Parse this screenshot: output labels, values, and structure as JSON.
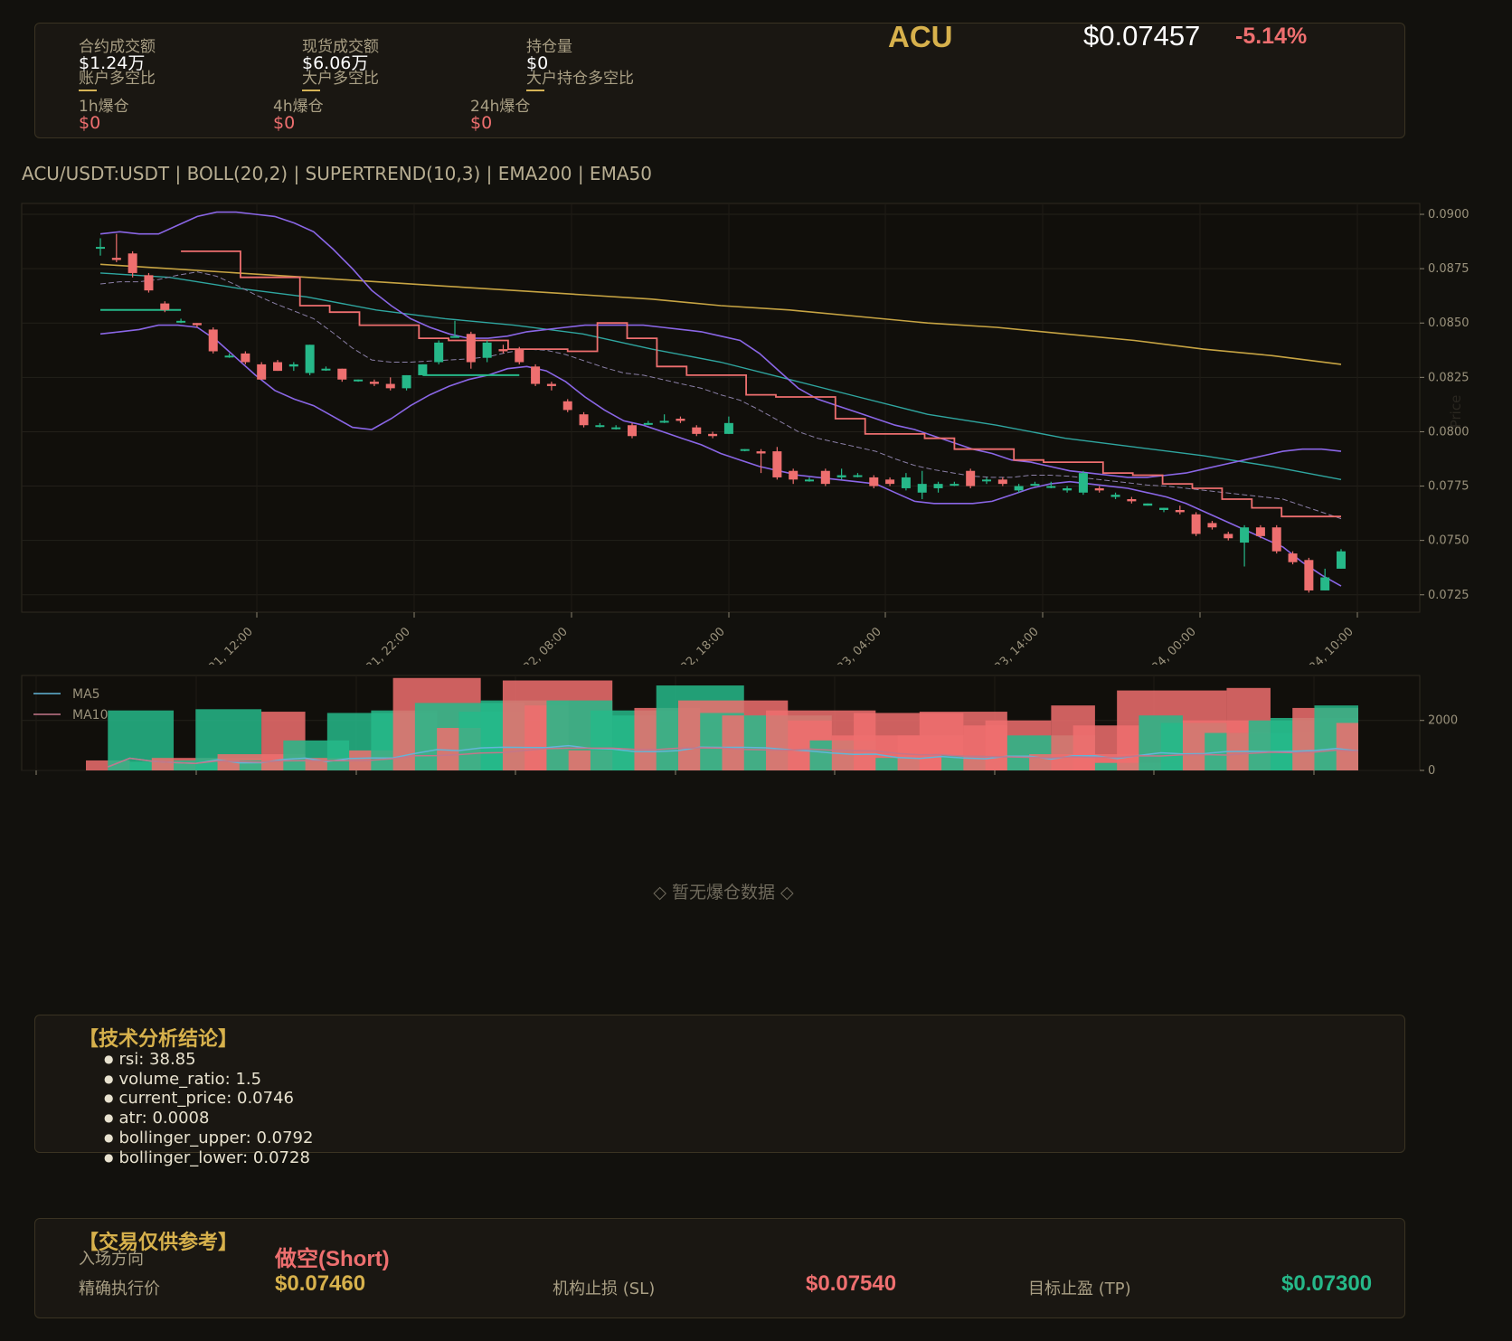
{
  "header": {
    "symbol": "ACU",
    "price": "$0.07457",
    "change": "-5.14%",
    "stats": [
      {
        "label": "合约成交额",
        "value": "$1.24万",
        "sub": "账户多空比"
      },
      {
        "label": "现货成交额",
        "value": "$6.06万",
        "sub": "大户多空比"
      },
      {
        "label": "持仓量",
        "value": "$0",
        "sub": "大户持仓多空比"
      }
    ],
    "liquidations": [
      {
        "label": "1h爆仓",
        "value": "$0"
      },
      {
        "label": "4h爆仓",
        "value": "$0"
      },
      {
        "label": "24h爆仓",
        "value": "$0"
      }
    ]
  },
  "chart_title": "ACU/USDT:USDT | BOLL(20,2) | SUPERTREND(10,3) | EMA200 | EMA50",
  "liquidation_empty": "◇ 暂无爆仓数据 ◇",
  "analysis": {
    "title": "【技术分析结论】",
    "items": [
      "rsi: 38.85",
      "volume_ratio: 1.5",
      "current_price: 0.0746",
      "atr: 0.0008",
      "bollinger_upper: 0.0792",
      "bollinger_lower: 0.0728"
    ]
  },
  "trade": {
    "title": "【交易仅供参考】",
    "direction_label": "入场方向",
    "direction_value": "做空(Short)",
    "entry_label": "精确执行价",
    "entry_value": "$0.07460",
    "sl_label": "机构止损 (SL)",
    "sl_value": "$0.07540",
    "tp_label": "目标止盈 (TP)",
    "tp_value": "$0.07300"
  },
  "colors": {
    "up": "#26b889",
    "down": "#ee6f6f",
    "ema200": "#c7a443",
    "ema50": "#2fa6a0",
    "boll": "#8a66e6",
    "supertrend": "#ee6f6f",
    "accent": "#d7b14c"
  },
  "chart_data": [
    {
      "type": "candlestick",
      "y_label": "Price",
      "ylim": [
        0.0717,
        0.0905
      ],
      "yticks": [
        "0.0725",
        "0.0750",
        "0.0775",
        "0.0800",
        "0.0825",
        "0.0850",
        "0.0875",
        "0.0900"
      ],
      "xticks": [
        "Jun 21, 12:00",
        "Jun 21, 22:00",
        "Jun 22, 08:00",
        "Jun 22, 18:00",
        "Jun 23, 04:00",
        "Jun 23, 14:00",
        "Jun 24, 00:00",
        "Jun 24, 10:00"
      ],
      "candles": [
        [
          0.0885,
          0.0889,
          0.0881,
          0.0885
        ],
        [
          0.088,
          0.0891,
          0.0878,
          0.0879
        ],
        [
          0.0882,
          0.0883,
          0.0871,
          0.0873
        ],
        [
          0.0872,
          0.0873,
          0.0864,
          0.0865
        ],
        [
          0.0859,
          0.086,
          0.0855,
          0.0856
        ],
        [
          0.0851,
          0.0852,
          0.085,
          0.0851
        ],
        [
          0.085,
          0.085,
          0.0848,
          0.0849
        ],
        [
          0.0847,
          0.0848,
          0.0836,
          0.0837
        ],
        [
          0.0835,
          0.0836,
          0.0834,
          0.0835
        ],
        [
          0.0836,
          0.0837,
          0.0831,
          0.0832
        ],
        [
          0.0831,
          0.0832,
          0.0824,
          0.0824
        ],
        [
          0.0832,
          0.0833,
          0.0828,
          0.0828
        ],
        [
          0.083,
          0.0832,
          0.0828,
          0.0831
        ],
        [
          0.0827,
          0.084,
          0.0826,
          0.084
        ],
        [
          0.0829,
          0.083,
          0.0828,
          0.0829
        ],
        [
          0.0829,
          0.0829,
          0.0823,
          0.0824
        ],
        [
          0.0824,
          0.0824,
          0.0823,
          0.0824
        ],
        [
          0.0823,
          0.0824,
          0.0821,
          0.0822
        ],
        [
          0.0822,
          0.0825,
          0.0819,
          0.082
        ],
        [
          0.082,
          0.0826,
          0.0819,
          0.0826
        ],
        [
          0.0826,
          0.0831,
          0.0826,
          0.0831
        ],
        [
          0.0832,
          0.0842,
          0.0831,
          0.0841
        ],
        [
          0.0844,
          0.0851,
          0.0844,
          0.0844
        ],
        [
          0.0845,
          0.0846,
          0.0829,
          0.0832
        ],
        [
          0.0834,
          0.0842,
          0.0832,
          0.0841
        ],
        [
          0.0838,
          0.084,
          0.0836,
          0.0837
        ],
        [
          0.0838,
          0.0839,
          0.0831,
          0.0832
        ],
        [
          0.083,
          0.0831,
          0.0821,
          0.0822
        ],
        [
          0.0822,
          0.0823,
          0.0819,
          0.0821
        ],
        [
          0.0814,
          0.0815,
          0.0809,
          0.081
        ],
        [
          0.0808,
          0.0809,
          0.0802,
          0.0803
        ],
        [
          0.0803,
          0.0804,
          0.0802,
          0.0803
        ],
        [
          0.0802,
          0.0803,
          0.0801,
          0.0802
        ],
        [
          0.0803,
          0.0804,
          0.0797,
          0.0798
        ],
        [
          0.0804,
          0.0805,
          0.0803,
          0.0804
        ],
        [
          0.0805,
          0.0808,
          0.0804,
          0.0805
        ],
        [
          0.0806,
          0.0807,
          0.0804,
          0.0805
        ],
        [
          0.0802,
          0.0803,
          0.0798,
          0.0799
        ],
        [
          0.0799,
          0.08,
          0.0797,
          0.0798
        ],
        [
          0.0799,
          0.0807,
          0.0799,
          0.0804
        ],
        [
          0.0792,
          0.0792,
          0.0791,
          0.0792
        ],
        [
          0.0791,
          0.0792,
          0.0781,
          0.079
        ],
        [
          0.0791,
          0.0793,
          0.0778,
          0.0779
        ],
        [
          0.0782,
          0.0783,
          0.0776,
          0.0778
        ],
        [
          0.0778,
          0.0779,
          0.0777,
          0.0778
        ],
        [
          0.0782,
          0.0783,
          0.0775,
          0.0776
        ],
        [
          0.0779,
          0.0783,
          0.0778,
          0.078
        ],
        [
          0.078,
          0.0781,
          0.0779,
          0.078
        ],
        [
          0.0779,
          0.078,
          0.0774,
          0.0775
        ],
        [
          0.0778,
          0.0779,
          0.0775,
          0.0776
        ],
        [
          0.0774,
          0.0781,
          0.0773,
          0.0779
        ],
        [
          0.0772,
          0.0782,
          0.0769,
          0.0776
        ],
        [
          0.0774,
          0.0777,
          0.0772,
          0.0776
        ],
        [
          0.0776,
          0.0777,
          0.0775,
          0.0776
        ],
        [
          0.0782,
          0.0783,
          0.0774,
          0.0775
        ],
        [
          0.0778,
          0.0779,
          0.0776,
          0.0778
        ],
        [
          0.0778,
          0.0779,
          0.0775,
          0.0776
        ],
        [
          0.0773,
          0.0776,
          0.0772,
          0.0775
        ],
        [
          0.0776,
          0.0777,
          0.0775,
          0.0776
        ],
        [
          0.0775,
          0.0777,
          0.0774,
          0.0775
        ],
        [
          0.0773,
          0.0775,
          0.0772,
          0.0774
        ],
        [
          0.0772,
          0.0782,
          0.0771,
          0.0781
        ],
        [
          0.0774,
          0.0775,
          0.0772,
          0.0773
        ],
        [
          0.077,
          0.0772,
          0.0769,
          0.0771
        ],
        [
          0.0769,
          0.077,
          0.0767,
          0.0768
        ],
        [
          0.0766,
          0.0767,
          0.0766,
          0.0767
        ],
        [
          0.0764,
          0.0765,
          0.0763,
          0.0765
        ],
        [
          0.0764,
          0.0766,
          0.0762,
          0.0763
        ],
        [
          0.0762,
          0.0763,
          0.0752,
          0.0753
        ],
        [
          0.0758,
          0.0759,
          0.0755,
          0.0756
        ],
        [
          0.0753,
          0.0754,
          0.075,
          0.0751
        ],
        [
          0.0749,
          0.0757,
          0.0738,
          0.0756
        ],
        [
          0.0756,
          0.0757,
          0.0751,
          0.0752
        ],
        [
          0.0756,
          0.0757,
          0.0744,
          0.0745
        ],
        [
          0.0744,
          0.0745,
          0.0739,
          0.074
        ],
        [
          0.0741,
          0.0742,
          0.0726,
          0.0727
        ],
        [
          0.0727,
          0.0737,
          0.0727,
          0.0733
        ],
        [
          0.0737,
          0.0746,
          0.0737,
          0.0745
        ]
      ],
      "boll_upper": [
        0.0891,
        0.0892,
        0.0891,
        0.0891,
        0.0895,
        0.0899,
        0.0901,
        0.0901,
        0.09,
        0.0899,
        0.0896,
        0.0892,
        0.0884,
        0.0875,
        0.0865,
        0.0858,
        0.0852,
        0.0848,
        0.0845,
        0.0843,
        0.0843,
        0.0844,
        0.0846,
        0.0847,
        0.0848,
        0.0849,
        0.0849,
        0.0849,
        0.0849,
        0.0848,
        0.0847,
        0.0846,
        0.0844,
        0.0842,
        0.0836,
        0.0828,
        0.082,
        0.0815,
        0.0812,
        0.0809,
        0.0806,
        0.0803,
        0.0801,
        0.0798,
        0.0795,
        0.0792,
        0.079,
        0.0787,
        0.0786,
        0.0784,
        0.0782,
        0.0781,
        0.078,
        0.0779,
        0.0779,
        0.078,
        0.0781,
        0.0783,
        0.0785,
        0.0787,
        0.0789,
        0.0791,
        0.0792,
        0.0792,
        0.0791
      ],
      "boll_lower": [
        0.0845,
        0.0846,
        0.0847,
        0.0849,
        0.0849,
        0.0848,
        0.0842,
        0.0834,
        0.0826,
        0.0819,
        0.0815,
        0.0812,
        0.0807,
        0.0802,
        0.0801,
        0.0806,
        0.0812,
        0.0817,
        0.0821,
        0.0824,
        0.0826,
        0.0829,
        0.083,
        0.0828,
        0.0823,
        0.0816,
        0.081,
        0.0805,
        0.0803,
        0.08,
        0.0797,
        0.0794,
        0.079,
        0.0787,
        0.0784,
        0.0782,
        0.078,
        0.0779,
        0.0778,
        0.0777,
        0.0776,
        0.0772,
        0.0768,
        0.0767,
        0.0767,
        0.0767,
        0.0768,
        0.0771,
        0.0774,
        0.0776,
        0.0777,
        0.0776,
        0.0775,
        0.0774,
        0.0772,
        0.077,
        0.0767,
        0.0763,
        0.0759,
        0.0755,
        0.0751,
        0.0747,
        0.074,
        0.0734,
        0.0729
      ],
      "ema200": [
        0.0877,
        0.0875,
        0.0873,
        0.0871,
        0.0869,
        0.0867,
        0.0865,
        0.0863,
        0.0861,
        0.0858,
        0.0856,
        0.0853,
        0.085,
        0.0848,
        0.0845,
        0.0842,
        0.0838,
        0.0835,
        0.0831
      ],
      "ema50": [
        0.0873,
        0.0871,
        0.0866,
        0.0862,
        0.0856,
        0.0852,
        0.0849,
        0.0845,
        0.0838,
        0.0832,
        0.0824,
        0.0816,
        0.0808,
        0.0803,
        0.0797,
        0.0793,
        0.0789,
        0.0784,
        0.0778
      ],
      "supertrend_down": [
        0.0883,
        0.0883,
        0.0871,
        0.0871,
        0.0858,
        0.0855,
        0.0849,
        0.0849,
        0.0843,
        0.0842,
        0.0842,
        0.0838,
        0.0838,
        0.0837,
        0.085,
        0.0843,
        0.083,
        0.0826,
        0.0826,
        0.0817,
        0.0816,
        0.0816,
        0.0806,
        0.0799,
        0.0799,
        0.0797,
        0.0792,
        0.0792,
        0.0787,
        0.0786,
        0.0786,
        0.0781,
        0.078,
        0.0776,
        0.0774,
        0.0769,
        0.0765,
        0.0761,
        0.0761
      ],
      "supertrend_up": [
        0.0856,
        0.0856,
        0.0856,
        0.0826,
        0.0826,
        0.0826
      ]
    },
    {
      "type": "bar",
      "series": [
        {
          "name": "MA5"
        },
        {
          "name": "MA10"
        }
      ],
      "yticks": [
        "0",
        "2000"
      ],
      "ylim": [
        0,
        3800
      ],
      "volumes": [
        [
          0,
          400
        ],
        [
          1,
          2400
        ],
        [
          1,
          350
        ],
        [
          0,
          500
        ],
        [
          1,
          400
        ],
        [
          1,
          2450
        ],
        [
          0,
          650
        ],
        [
          1,
          400
        ],
        [
          0,
          2350
        ],
        [
          1,
          1200
        ],
        [
          0,
          500
        ],
        [
          1,
          2300
        ],
        [
          0,
          800
        ],
        [
          1,
          2400
        ],
        [
          0,
          3700
        ],
        [
          1,
          2700
        ],
        [
          0,
          1700
        ],
        [
          1,
          2350
        ],
        [
          1,
          2800
        ],
        [
          0,
          3600
        ],
        [
          0,
          2600
        ],
        [
          1,
          2800
        ],
        [
          0,
          800
        ],
        [
          1,
          2400
        ],
        [
          1,
          2200
        ],
        [
          0,
          2500
        ],
        [
          1,
          3400
        ],
        [
          0,
          2800
        ],
        [
          1,
          2300
        ],
        [
          0,
          2200
        ],
        [
          1,
          2200
        ],
        [
          0,
          2400
        ],
        [
          0,
          2000
        ],
        [
          1,
          1200
        ],
        [
          0,
          1400
        ],
        [
          0,
          2300
        ],
        [
          1,
          500
        ],
        [
          0,
          1400
        ],
        [
          0,
          2350
        ],
        [
          1,
          600
        ],
        [
          0,
          1800
        ],
        [
          0,
          2000
        ],
        [
          1,
          1400
        ],
        [
          0,
          650
        ],
        [
          0,
          2600
        ],
        [
          0,
          1800
        ],
        [
          1,
          300
        ],
        [
          0,
          3200
        ],
        [
          1,
          2200
        ],
        [
          1,
          1900
        ],
        [
          0,
          2000
        ],
        [
          1,
          1500
        ],
        [
          0,
          3300
        ],
        [
          1,
          2000
        ],
        [
          1,
          2100
        ],
        [
          0,
          2500
        ],
        [
          1,
          2600
        ],
        [
          0,
          1900
        ]
      ]
    }
  ]
}
